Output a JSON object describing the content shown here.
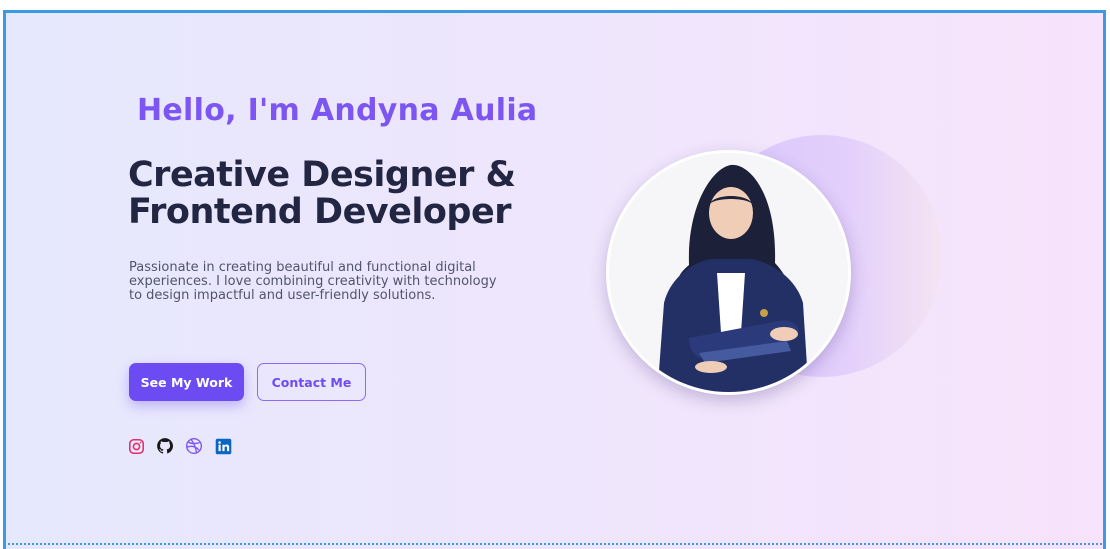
{
  "hero": {
    "greeting": "Hello, I'm Andyna Aulia",
    "headline_line1": "Creative Designer &",
    "headline_line2": "Frontend Developer",
    "bio": "Passionate in creating beautiful and functional digital experiences. I love combining creativity with technology to design impactful and user-friendly solutions.",
    "primary_button": "See My Work",
    "secondary_button": "Contact Me"
  },
  "socials": [
    {
      "name": "instagram-icon",
      "color": "#e1306c"
    },
    {
      "name": "github-icon",
      "color": "#181717"
    },
    {
      "name": "dribbble-icon",
      "color": "#7c55f3"
    },
    {
      "name": "linkedin-icon",
      "color": "#0a66c2"
    }
  ],
  "colors": {
    "accent": "#7c55f3",
    "button": "#6c4cf2",
    "heading": "#232643",
    "frame_border": "#3b9ae6"
  }
}
